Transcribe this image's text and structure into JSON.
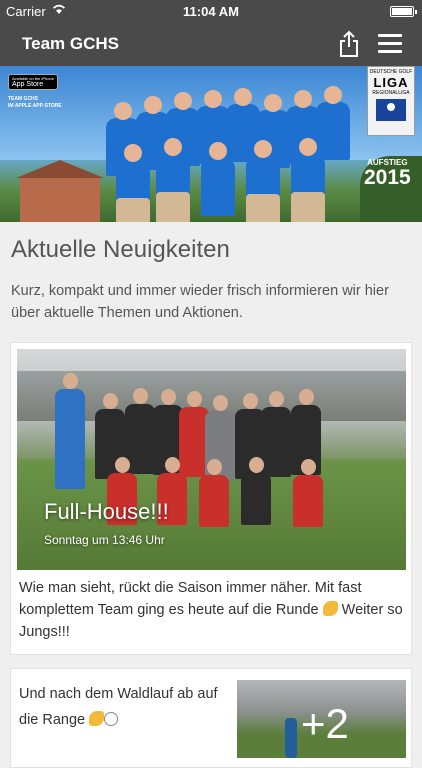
{
  "status_bar": {
    "carrier": "Carrier",
    "time": "11:04 AM"
  },
  "navbar": {
    "title": "Team GCHS",
    "share_icon": "share-icon",
    "menu_icon": "hamburger-menu-icon"
  },
  "banner": {
    "appstore_badge_small": "Available on the iPhone",
    "appstore_badge": "App Store",
    "appstore_caption_line1": "TEAM GCHS",
    "appstore_caption_line2": "IM APPLE APP-STORE",
    "liga_line1": "DEUTSCHE GOLF",
    "liga_big": "LIGA",
    "liga_line2": "REGIONALLIGA",
    "aufstieg": "AUFSTIEG",
    "year": "2015"
  },
  "section": {
    "heading": "Aktuelle Neuigkeiten",
    "lead": "Kurz, kompakt und immer wieder frisch informieren wir hier über aktuelle Themen und Aktionen."
  },
  "posts": [
    {
      "title": "Full-House!!!",
      "date": "Sonntag um 13:46 Uhr",
      "body_part1": "Wie man sieht, rückt die Saison immer näher. Mit fast komplettem Team ging es heute auf die Runde ",
      "body_part2": " Weiter so Jungs!!!"
    },
    {
      "text": "Und nach dem Waldlauf ab auf die Range ",
      "thumb_overlay": "+2"
    }
  ]
}
